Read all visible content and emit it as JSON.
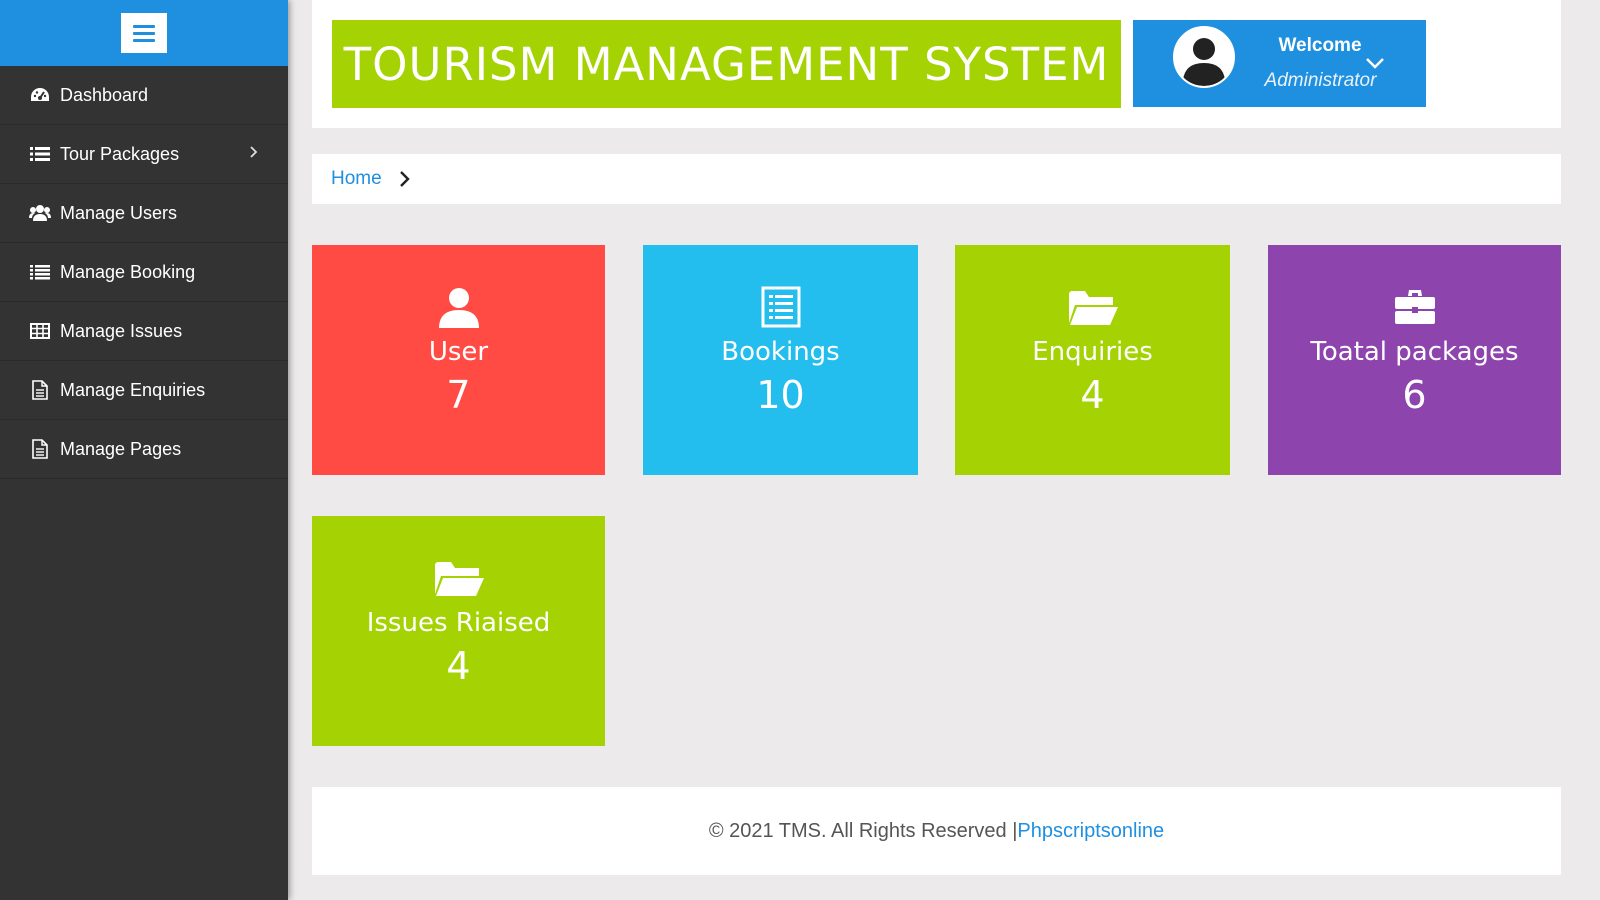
{
  "sidebar": {
    "toggle_icon": "hamburger-icon",
    "items": [
      {
        "label": "Dashboard",
        "icon": "dashboard-gauge-icon"
      },
      {
        "label": "Tour Packages",
        "icon": "list-icon",
        "has_submenu": true
      },
      {
        "label": "Manage Users",
        "icon": "users-icon"
      },
      {
        "label": "Manage Booking",
        "icon": "list-icon"
      },
      {
        "label": "Manage Issues",
        "icon": "table-icon"
      },
      {
        "label": "Manage Enquiries",
        "icon": "file-icon"
      },
      {
        "label": "Manage Pages",
        "icon": "file-icon"
      }
    ]
  },
  "header": {
    "title": "TOURISM MANAGEMENT SYSTEM",
    "welcome": "Welcome",
    "role": "Administrator"
  },
  "breadcrumb": {
    "home": "Home"
  },
  "cards": [
    {
      "label": "User",
      "value": "7",
      "color": "#ff4b43",
      "icon": "user-icon"
    },
    {
      "label": "Bookings",
      "value": "10",
      "color": "#23bdee",
      "icon": "list-alt-icon"
    },
    {
      "label": "Enquiries",
      "value": "4",
      "color": "#a4d203",
      "icon": "folder-open-icon"
    },
    {
      "label": "Toatal packages",
      "value": "6",
      "color": "#8e44ad",
      "icon": "briefcase-icon"
    },
    {
      "label": "Issues Riaised",
      "value": "4",
      "color": "#a4d203",
      "icon": "folder-open-icon"
    }
  ],
  "footer": {
    "text": "© 2021 TMS. All Rights Reserved | ",
    "link": "Phpscriptsonline"
  },
  "colors": {
    "sidebar_bg": "#333333",
    "accent_blue": "#1f8fe0",
    "title_green": "#a4d203"
  }
}
